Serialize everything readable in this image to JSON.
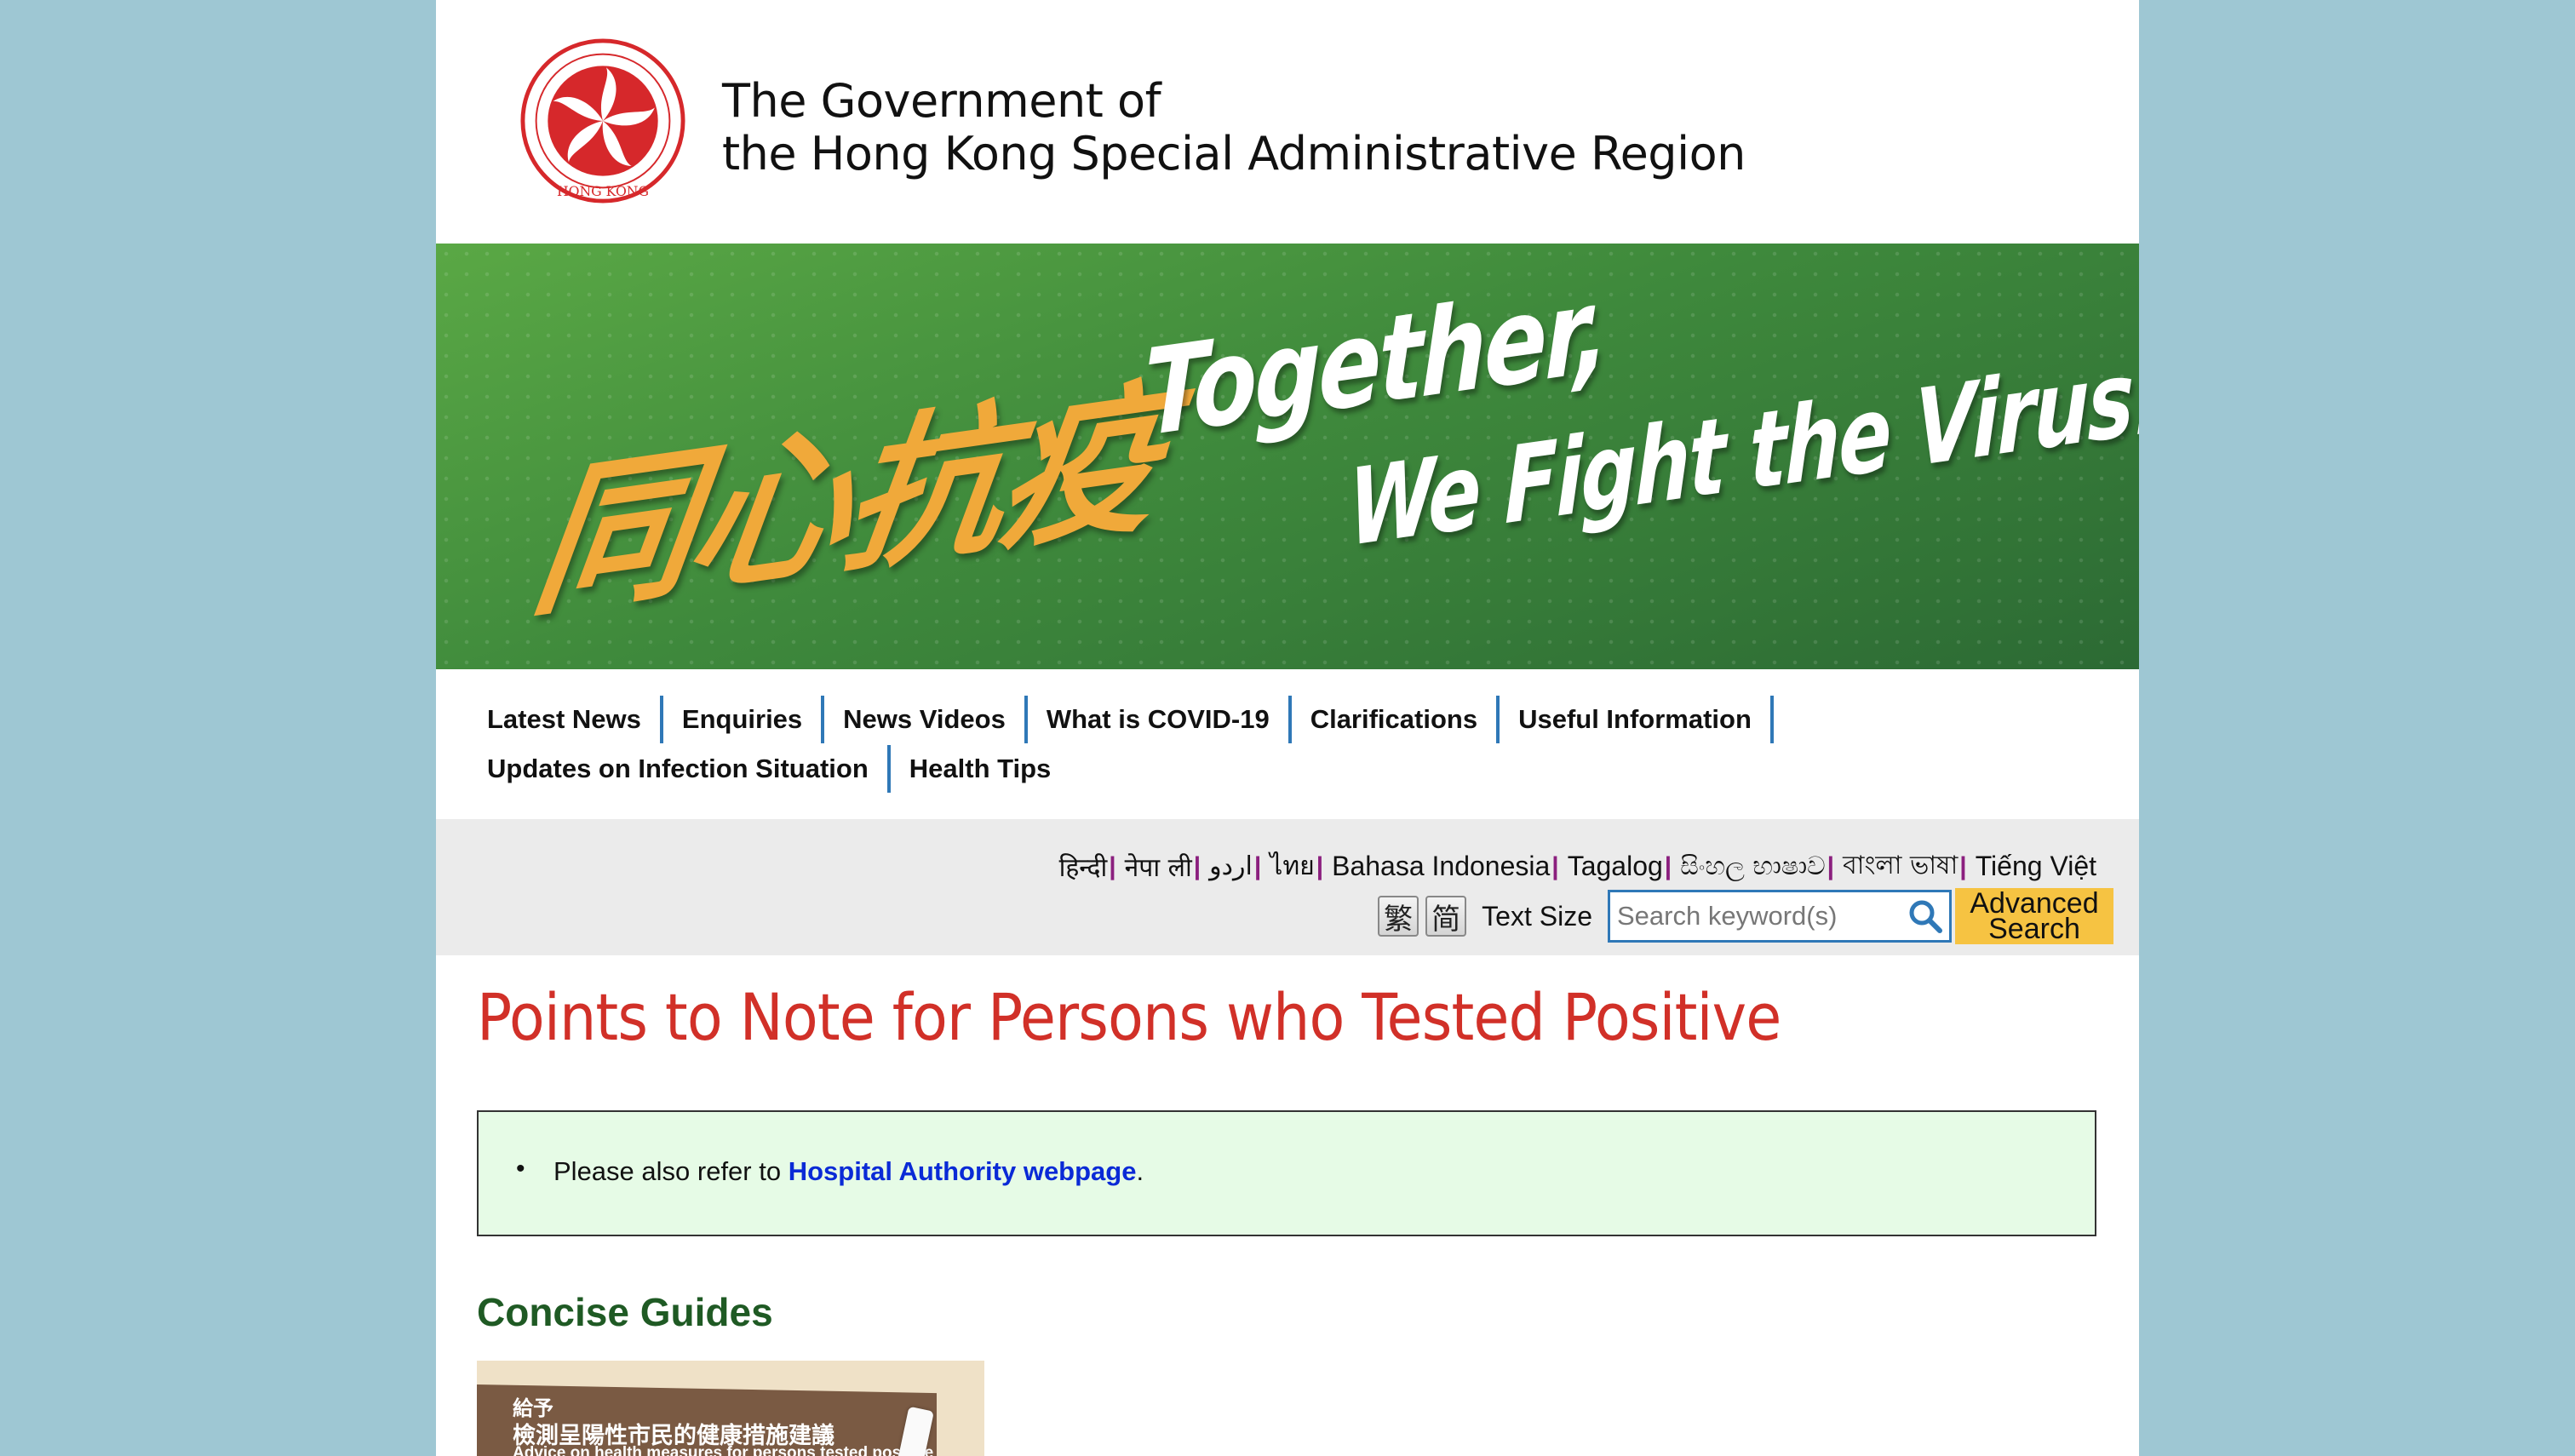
{
  "header": {
    "emblem_text": "HONG KONG",
    "title_line1": "The Government of",
    "title_line2": "the Hong Kong Special Administrative Region"
  },
  "banner": {
    "chinese": "同心抗疫",
    "english_line1": "Together,",
    "english_line2": "We Fight the Virus!"
  },
  "nav": {
    "row1": [
      "Latest News",
      "Enquiries",
      "News Videos",
      "What is COVID-19",
      "Clarifications",
      "Useful Information"
    ],
    "row2": [
      "Updates on Infection Situation",
      "Health Tips"
    ]
  },
  "languages": [
    "हिन्दी",
    "नेपा ली",
    "اردو",
    "ไทย",
    "Bahasa Indonesia",
    "Tagalog",
    "සිංහල භාෂාව",
    "বাংলা ভাষা",
    "Tiếng Việt"
  ],
  "tools": {
    "traditional_chinese": "繁",
    "simplified_chinese": "简",
    "text_size": "Text Size",
    "search_placeholder": "Search keyword(s)",
    "advanced_search_line1": "Advanced",
    "advanced_search_line2": "Search"
  },
  "main": {
    "title": "Points to Note for Persons who Tested Positive",
    "note_prefix": "Please also refer to ",
    "note_link": "Hospital Authority webpage",
    "note_suffix": ".",
    "concise_guides": "Concise Guides",
    "guide_thumb": {
      "label1": "給予",
      "label2": "檢測呈陽性市民的健康措施建議",
      "label3": "Advice on health measures for persons tested positive"
    }
  },
  "colors": {
    "background": "#9ec7d3",
    "title_red": "#d13028",
    "nav_separator": "#2f78b7",
    "lang_separator": "#8b1f7e",
    "advanced_search_bg": "#f6c342",
    "note_bg": "#e6fbe6",
    "link_blue": "#0a2ad6",
    "section_green": "#1f5a24"
  }
}
